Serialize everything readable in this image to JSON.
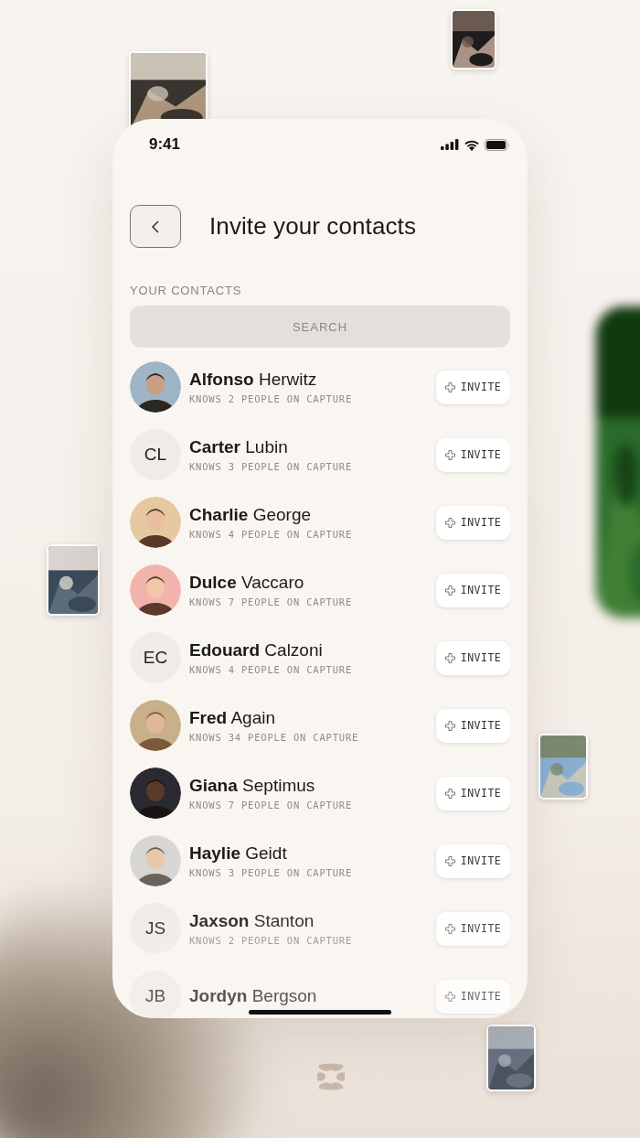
{
  "status_bar": {
    "time": "9:41"
  },
  "header": {
    "title": "Invite your contacts"
  },
  "section_label": "YOUR CONTACTS",
  "search": {
    "placeholder": "SEARCH"
  },
  "contacts": [
    {
      "name": "**Alfonso** Herwitz",
      "subtitle": "KNOWS 2 PEOPLE ON CAPTURE",
      "button": "INVITE"
    },
    {
      "name": "**Carter** Lubin",
      "subtitle": "KNOWS 3 PEOPLE ON CAPTURE",
      "avatar": {
        "kind": "initials",
        "text": "CL"
      },
      "button": "INVITE"
    },
    {
      "name": "**Charlie** George",
      "subtitle": "KNOWS 4 PEOPLE ON CAPTURE",
      "button": "INVITE"
    },
    {
      "name": "**Dulce** Vaccaro",
      "subtitle": "KNOWS 7 PEOPLE ON CAPTURE",
      "button": "INVITE"
    },
    {
      "name": "**Edouard** Calzoni",
      "subtitle": "KNOWS 4 PEOPLE ON CAPTURE",
      "avatar": {
        "kind": "initials",
        "text": "EC"
      },
      "button": "INVITE"
    },
    {
      "name": "**Fred** Again",
      "subtitle": "KNOWS 34 PEOPLE ON CAPTURE",
      "button": "INVITE"
    },
    {
      "name": "**Giana** Septimus",
      "subtitle": "KNOWS 7 PEOPLE ON CAPTURE",
      "button": "INVITE"
    },
    {
      "name": "**Haylie** Geidt",
      "subtitle": "KNOWS 3 PEOPLE ON CAPTURE",
      "button": "INVITE"
    },
    {
      "name": "**Jaxson** Stanton",
      "subtitle": "KNOWS 2 PEOPLE ON CAPTURE",
      "avatar": {
        "kind": "initials",
        "text": "JS"
      },
      "button": "INVITE"
    },
    {
      "name": "**Jordyn** Bergson",
      "avatar": {
        "kind": "initials",
        "text": "JB"
      },
      "button": "INVITE"
    }
  ]
}
